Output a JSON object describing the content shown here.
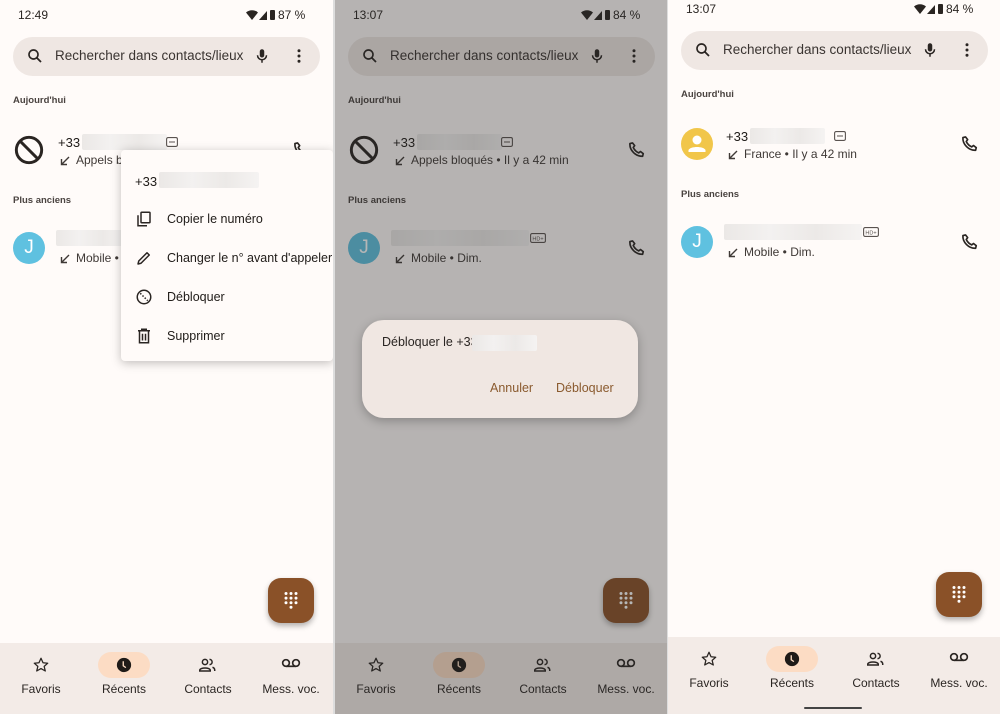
{
  "colors": {
    "accent": "#8a5128",
    "pill": "#fcdcc4",
    "navbar": "#f3ebe7",
    "search": "#efe7e3",
    "avatar_j": "#5fc1e0",
    "avatar_unknown": "#f1c64a",
    "dialog_button": "#8a5a2e"
  },
  "nav": [
    {
      "label": "Favoris",
      "icon": "star-icon"
    },
    {
      "label": "Récents",
      "icon": "clock-icon",
      "active": true
    },
    {
      "label": "Contacts",
      "icon": "people-icon"
    },
    {
      "label": "Mess. voc.",
      "icon": "voicemail-icon"
    }
  ],
  "panels": [
    {
      "status": {
        "time": "12:49",
        "battery": "87 %"
      },
      "search": {
        "placeholder": "Rechercher dans contacts/lieux"
      },
      "section_today": "Aujourd'hui",
      "section_older": "Plus anciens",
      "row1": {
        "name": "+33",
        "detail": "Appels b",
        "avatar": "block-icon"
      },
      "row2": {
        "initial": "J",
        "detail": "Mobile •"
      },
      "menu": {
        "number": "+33",
        "items": [
          {
            "label": "Copier le numéro",
            "icon": "copy-icon"
          },
          {
            "label": "Changer le n° avant d'appeler",
            "icon": "pencil-icon"
          },
          {
            "label": "Débloquer",
            "icon": "unblock-icon"
          },
          {
            "label": "Supprimer",
            "icon": "trash-icon"
          }
        ]
      }
    },
    {
      "status": {
        "time": "13:07",
        "battery": "84 %"
      },
      "search": {
        "placeholder": "Rechercher dans contacts/lieux"
      },
      "section_today": "Aujourd'hui",
      "section_older": "Plus anciens",
      "row1": {
        "name": "+33",
        "detail": "Appels bloqués • Il y a 42 min",
        "avatar": "block-icon"
      },
      "row2": {
        "initial": "J",
        "detail": "Mobile • Dim."
      },
      "dialog": {
        "title": "Débloquer le +33",
        "cancel": "Annuler",
        "confirm": "Débloquer"
      }
    },
    {
      "status": {
        "time": "13:07",
        "battery": "84 %"
      },
      "search": {
        "placeholder": "Rechercher dans contacts/lieux"
      },
      "section_today": "Aujourd'hui",
      "section_older": "Plus anciens",
      "row1": {
        "name": "+33",
        "detail": "France • Il y a 42 min",
        "avatar": "person-icon"
      },
      "row2": {
        "initial": "J",
        "detail": "Mobile • Dim."
      }
    }
  ]
}
